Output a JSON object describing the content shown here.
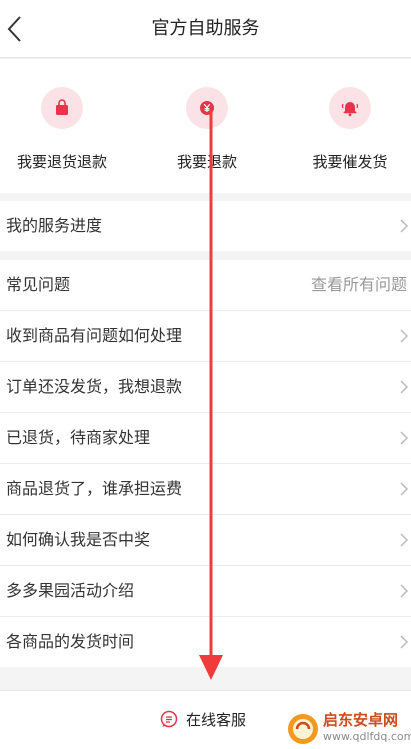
{
  "header": {
    "title": "官方自助服务"
  },
  "quick_actions": [
    {
      "label": "我要退货退款",
      "icon": "bag-icon"
    },
    {
      "label": "我要退款",
      "icon": "yen-icon"
    },
    {
      "label": "我要催发货",
      "icon": "bell-icon"
    }
  ],
  "progress": {
    "label": "我的服务进度"
  },
  "faq": {
    "title": "常见问题",
    "view_all": "查看所有问题",
    "items": [
      "收到商品有问题如何处理",
      "订单还没发货，我想退款",
      "已退货，待商家处理",
      "商品退货了，谁承担运费",
      "如何确认我是否中奖",
      "多多果园活动介绍",
      "各商品的发货时间"
    ]
  },
  "footer": {
    "customer_service": "在线客服"
  },
  "watermark": {
    "name": "启东安卓网",
    "url": "www.qdlfdq.com"
  },
  "colors": {
    "accent": "#e8344a",
    "icon_bg": "#fbe2e6",
    "arrow": "#f03b3b"
  }
}
